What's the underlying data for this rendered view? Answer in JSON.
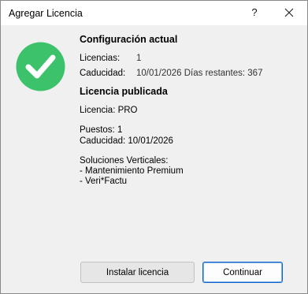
{
  "window": {
    "title": "Agregar Licencia",
    "help_label": "?",
    "colors": {
      "accent": "#0a63c9",
      "check": "#3cc26a"
    }
  },
  "current_config": {
    "heading": "Configuración actual",
    "licenses_label": "Licencias:",
    "licenses_value": "1",
    "expiry_label": "Caducidad:",
    "expiry_value": "10/01/2026 Días restantes: 367"
  },
  "published_license": {
    "heading": "Licencia publicada",
    "license_line": "Licencia: PRO",
    "seats_line": "Puestos: 1",
    "expiry_line": "Caducidad: 10/01/2026",
    "vertical_heading": "Soluciones Verticales:",
    "vertical_items": [
      "- Mantenimiento Premium",
      "- Veri*Factu"
    ]
  },
  "buttons": {
    "install_label": "Instalar licencia",
    "continue_label": "Continuar"
  }
}
